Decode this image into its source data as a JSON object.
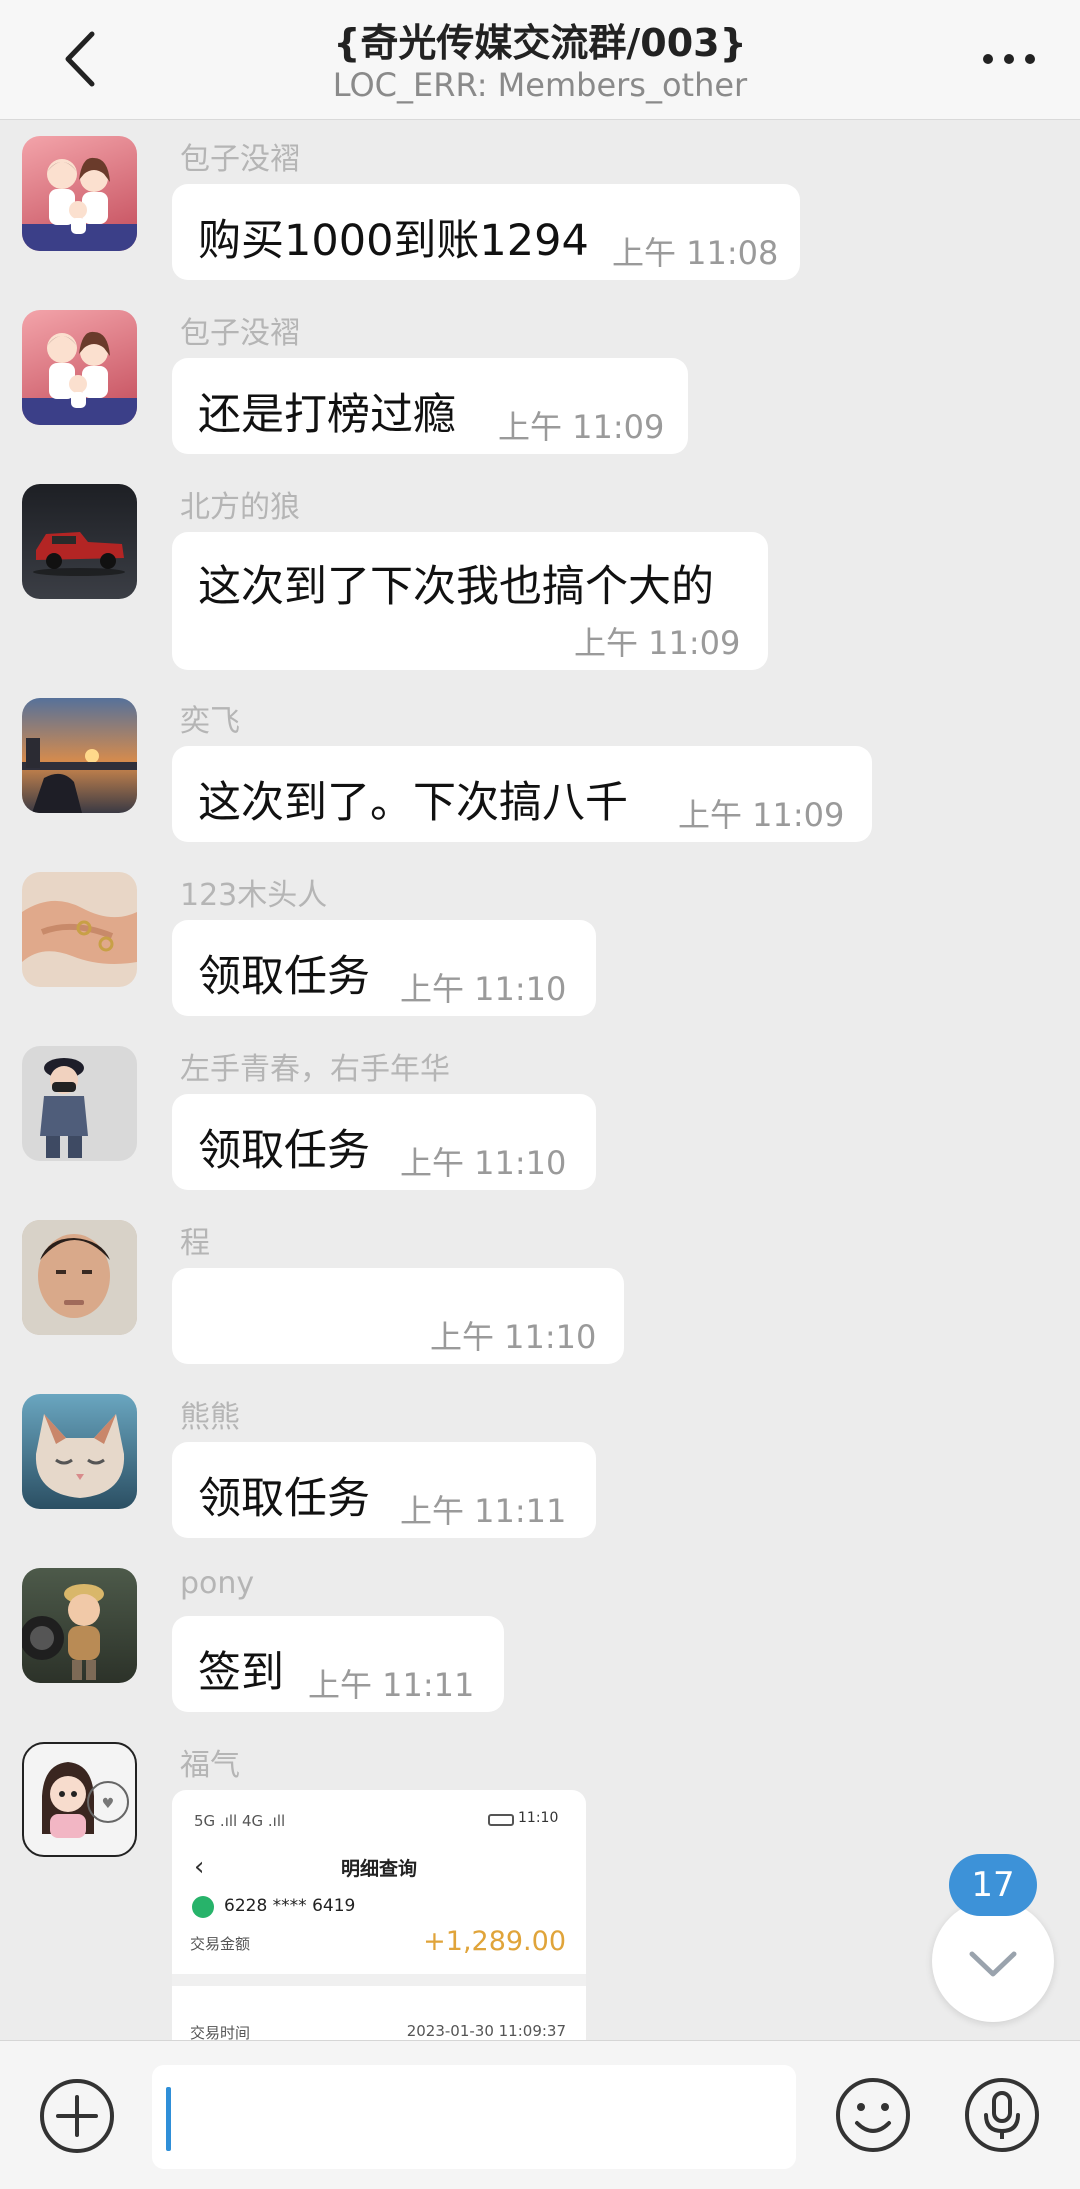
{
  "header": {
    "title": "{奇光传媒交流群/003}",
    "subtitle": "LOC_ERR: Members_other"
  },
  "messages": [
    {
      "sender": "包子没褶",
      "text": "购买1000到账1294",
      "time": "上午 11:08",
      "avatar": "couple-cartoon-avatar"
    },
    {
      "sender": "包子没褶",
      "text": "还是打榜过瘾",
      "time": "上午 11:09",
      "avatar": "couple-cartoon-avatar"
    },
    {
      "sender": "北方的狼",
      "text": "这次到了下次我也搞个大的",
      "time": "上午 11:09",
      "avatar": "red-truck-avatar"
    },
    {
      "sender": "奕飞",
      "text": "这次到了。下次搞八千",
      "time": "上午 11:09",
      "avatar": "sunset-city-avatar"
    },
    {
      "sender": "123木头人",
      "text": "领取任务",
      "time": "上午 11:10",
      "avatar": "hands-rings-avatar"
    },
    {
      "sender": "左手青春，右手年华",
      "text": "领取任务",
      "time": "上午 11:10",
      "avatar": "masked-figure-avatar"
    },
    {
      "sender": "程",
      "text": "",
      "time": "上午 11:10",
      "avatar": "man-selfie-avatar"
    },
    {
      "sender": "熊熊",
      "text": "领取任务",
      "time": "上午 11:11",
      "avatar": "sleepy-cat-avatar"
    },
    {
      "sender": "pony",
      "text": "签到",
      "time": "上午 11:11",
      "avatar": "baby-worker-avatar"
    },
    {
      "sender": "福气",
      "text": "",
      "time": "",
      "avatar": "cartoon-girl-avatar"
    }
  ],
  "receipt": {
    "status_bar": "5G .ıll 4G .ıll",
    "clock": "11:10",
    "title": "明细查询",
    "card": "6228 **** 6419",
    "amount_label": "交易金额",
    "amount": "+1,289.00",
    "time_label": "交易时间",
    "time": "2023-01-30 11:09:37"
  },
  "unread_count": "17",
  "input": {
    "placeholder": ""
  },
  "colors": {
    "accent": "#3d92d8",
    "background": "#ececec",
    "bubble": "#ffffff",
    "amount": "#e0a43a"
  }
}
